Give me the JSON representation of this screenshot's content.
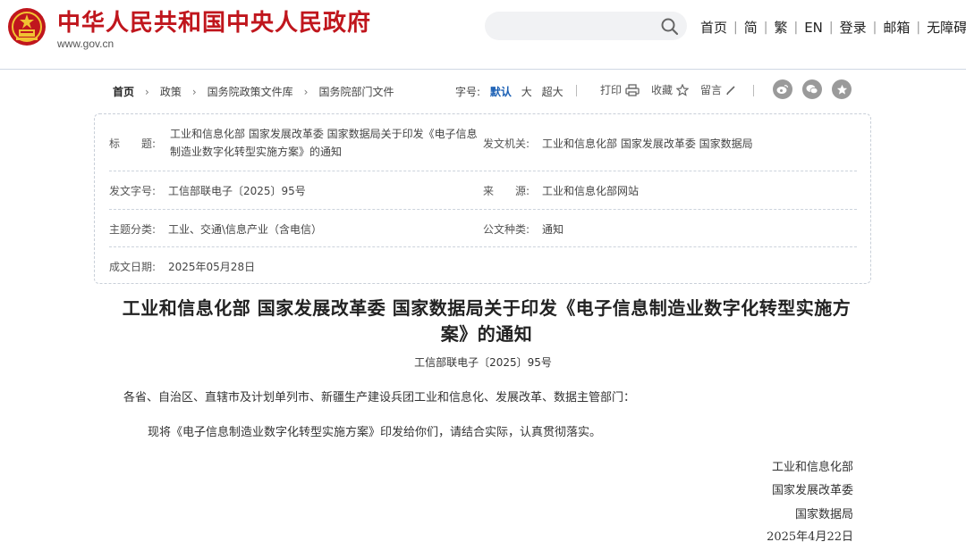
{
  "header": {
    "site_title": "中华人民共和国中央人民政府",
    "domain": "www.gov.cn",
    "search": {
      "placeholder": "",
      "value": ""
    },
    "nav": [
      "首页",
      "简",
      "繁",
      "EN",
      "登录",
      "邮箱",
      "无障碍"
    ]
  },
  "breadcrumb": [
    "首页",
    "政策",
    "国务院政策文件库",
    "国务院部门文件"
  ],
  "toolbar": {
    "fontsize_label": "字号:",
    "fontsize_options": [
      "默认",
      "大",
      "超大"
    ],
    "print_label": "打印",
    "favorite_label": "收藏",
    "comment_label": "留言",
    "share_icons": [
      "weibo-icon",
      "wechat-icon",
      "star-share-icon"
    ]
  },
  "info": {
    "title_label": "标　　题:",
    "title_value": "工业和信息化部 国家发展改革委 国家数据局关于印发《电子信息制造业数字化转型实施方案》的通知",
    "issuer_label": "发文机关:",
    "issuer_value": "工业和信息化部 国家发展改革委 国家数据局",
    "docno_label": "发文字号:",
    "docno_value": "工信部联电子〔2025〕95号",
    "source_label": "来　　源:",
    "source_value": "工业和信息化部网站",
    "topic_label": "主题分类:",
    "topic_value": "工业、交通\\信息产业（含电信）",
    "type_label": "公文种类:",
    "type_value": "通知",
    "date_label": "成文日期:",
    "date_value": "2025年05月28日"
  },
  "article": {
    "title": "工业和信息化部 国家发展改革委 国家数据局关于印发《电子信息制造业数字化转型实施方案》的通知",
    "doc_number": "工信部联电子〔2025〕95号",
    "salutation": "各省、自治区、直辖市及计划单列市、新疆生产建设兵团工业和信息化、发展改革、数据主管部门：",
    "body": "现将《电子信息制造业数字化转型实施方案》印发给你们，请结合实际，认真贯彻落实。",
    "signatures": [
      "工业和信息化部",
      "国家发展改革委",
      "国家数据局",
      "2025年4月22日"
    ]
  },
  "colors": {
    "brand_red": "#c0161d",
    "link_blue": "#1a5fb4",
    "share_gray": "#9a9a9a"
  }
}
